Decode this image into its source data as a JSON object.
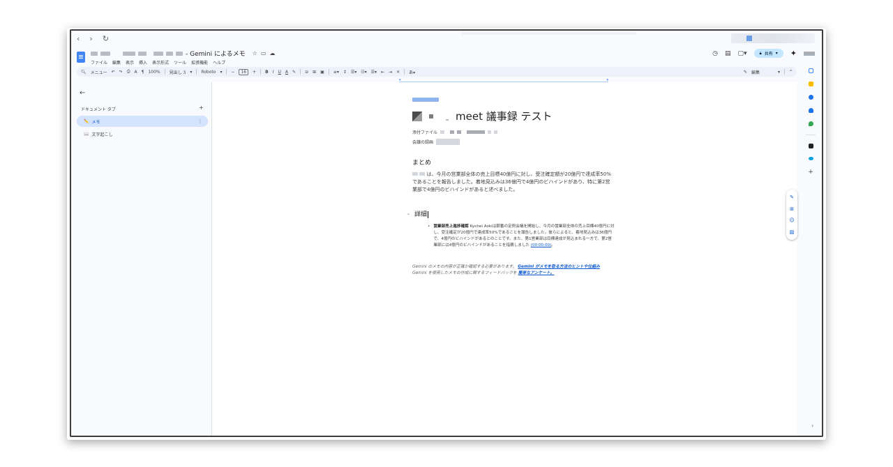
{
  "browser": {
    "back": "‹",
    "forward": "›",
    "reload": "↻"
  },
  "header": {
    "title_suffix": "- Gemini によるメモ",
    "menu": [
      "ファイル",
      "編集",
      "表示",
      "挿入",
      "表示形式",
      "ツール",
      "拡張機能",
      "ヘルプ"
    ],
    "share_label": "共有"
  },
  "toolbar": {
    "menu_label": "メニュー",
    "zoom": "100%",
    "style": "見出し 3",
    "font": "Roboto",
    "font_size": "16",
    "edit_mode": "編集"
  },
  "sidebar": {
    "tabs_label": "ドキュメント タブ",
    "tabs": [
      {
        "label": "メモ"
      },
      {
        "label": "文字起こし"
      }
    ]
  },
  "doc": {
    "title": "meet 議事録 テスト",
    "attachment_label": "添付ファイル",
    "recording_label": "会議の録画",
    "summary_heading": "まとめ",
    "summary_text": "は、今月の営業部全体の売上目標40億円に対し、受注確定額が20億円で達成率50%であることを報告しました。着地見込みは36億円で4億円のビハインドがあり、特に第2営業部で4億円のビハインドがあると述べました。",
    "details_heading": "詳細",
    "bullet_title": "営業部売上進捗確認",
    "bullet_text": "Kyohei Aokiは朝番の定例会議を開始し、今月の営業部全体の売上目標40億円に対し、受注確定が20億円で達成率50%であることを報告しました。彼らによると、着地見込みは36億円で、4億円のビハインドがあるとのことです。また、第1営業部は目標達成が見込まれる一方で、第2営業部には4億円のビハインドがあることを指摘しました",
    "bullet_time": "(00:00:00)",
    "bullet_end": "。",
    "footnote1_text": "Gemini のメモの内容が正確か確認する必要があります。",
    "footnote1_link": "Gemini がメモを取る方法のヒントや仕組み",
    "footnote2_text": "Gemini を使用したメモの作成に関するフィードバックを",
    "footnote2_link": "簡単なアンケート。"
  },
  "colors": {
    "accent": "#0b57d0",
    "tab_active": "#d3e3fd",
    "share": "#c2e7ff"
  }
}
